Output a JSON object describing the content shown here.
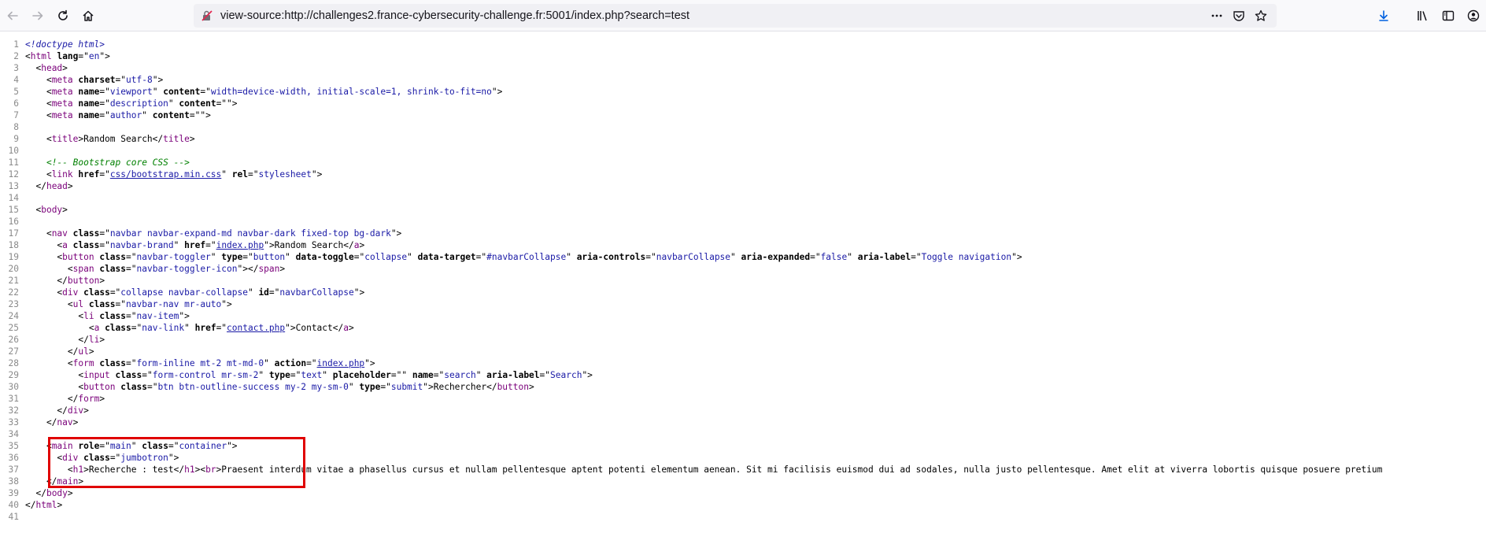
{
  "browser": {
    "url": "view-source:http://challenges2.france-cybersecurity-challenge.fr:5001/index.php?search=test",
    "icons": {
      "back": "back-arrow-icon",
      "forward": "forward-arrow-icon",
      "reload": "reload-icon",
      "home": "home-icon",
      "site_info": "site-info-icon",
      "page_actions": "more-icon",
      "pocket": "pocket-icon",
      "bookmark": "star-icon",
      "downloads": "download-icon",
      "library": "library-icon",
      "sidebar": "sidebar-icon",
      "account": "account-icon"
    }
  },
  "source": {
    "lines": [
      {
        "n": "1",
        "html": "<span class=\"dt\">&lt;!doctype html&gt;</span>"
      },
      {
        "n": "2",
        "html": "&lt;<span class=\"t\">html</span> <span class=\"an\">lang</span>=\"<span class=\"av\">en</span>\"&gt;"
      },
      {
        "n": "3",
        "html": "  &lt;<span class=\"t\">head</span>&gt;"
      },
      {
        "n": "4",
        "html": "    &lt;<span class=\"t\">meta</span> <span class=\"an\">charset</span>=\"<span class=\"av\">utf-8</span>\"&gt;"
      },
      {
        "n": "5",
        "html": "    &lt;<span class=\"t\">meta</span> <span class=\"an\">name</span>=\"<span class=\"av\">viewport</span>\" <span class=\"an\">content</span>=\"<span class=\"av\">width=device-width, initial-scale=1, shrink-to-fit=no</span>\"&gt;"
      },
      {
        "n": "6",
        "html": "    &lt;<span class=\"t\">meta</span> <span class=\"an\">name</span>=\"<span class=\"av\">description</span>\" <span class=\"an\">content</span>=\"\"&gt;"
      },
      {
        "n": "7",
        "html": "    &lt;<span class=\"t\">meta</span> <span class=\"an\">name</span>=\"<span class=\"av\">author</span>\" <span class=\"an\">content</span>=\"\"&gt;"
      },
      {
        "n": "8",
        "html": ""
      },
      {
        "n": "9",
        "html": "    &lt;<span class=\"t\">title</span>&gt;Random Search&lt;/<span class=\"t\">title</span>&gt;"
      },
      {
        "n": "10",
        "html": ""
      },
      {
        "n": "11",
        "html": "    <span class=\"cm\">&lt;!-- Bootstrap core CSS --&gt;</span>"
      },
      {
        "n": "12",
        "html": "    &lt;<span class=\"t\">link</span> <span class=\"an\">href</span>=\"<span class=\"lk\">css/bootstrap.min.css</span>\" <span class=\"an\">rel</span>=\"<span class=\"av\">stylesheet</span>\"&gt;"
      },
      {
        "n": "13",
        "html": "  &lt;/<span class=\"t\">head</span>&gt;"
      },
      {
        "n": "14",
        "html": ""
      },
      {
        "n": "15",
        "html": "  &lt;<span class=\"t\">body</span>&gt;"
      },
      {
        "n": "16",
        "html": ""
      },
      {
        "n": "17",
        "html": "    &lt;<span class=\"t\">nav</span> <span class=\"an\">class</span>=\"<span class=\"av\">navbar navbar-expand-md navbar-dark fixed-top bg-dark</span>\"&gt;"
      },
      {
        "n": "18",
        "html": "      &lt;<span class=\"t\">a</span> <span class=\"an\">class</span>=\"<span class=\"av\">navbar-brand</span>\" <span class=\"an\">href</span>=\"<span class=\"lk\">index.php</span>\"&gt;Random Search&lt;/<span class=\"t\">a</span>&gt;"
      },
      {
        "n": "19",
        "html": "      &lt;<span class=\"t\">button</span> <span class=\"an\">class</span>=\"<span class=\"av\">navbar-toggler</span>\" <span class=\"an\">type</span>=\"<span class=\"av\">button</span>\" <span class=\"an\">data-toggle</span>=\"<span class=\"av\">collapse</span>\" <span class=\"an\">data-target</span>=\"<span class=\"av\">#navbarCollapse</span>\" <span class=\"an\">aria-controls</span>=\"<span class=\"av\">navbarCollapse</span>\" <span class=\"an\">aria-expanded</span>=\"<span class=\"av\">false</span>\" <span class=\"an\">aria-label</span>=\"<span class=\"av\">Toggle navigation</span>\"&gt;"
      },
      {
        "n": "20",
        "html": "        &lt;<span class=\"t\">span</span> <span class=\"an\">class</span>=\"<span class=\"av\">navbar-toggler-icon</span>\"&gt;&lt;/<span class=\"t\">span</span>&gt;"
      },
      {
        "n": "21",
        "html": "      &lt;/<span class=\"t\">button</span>&gt;"
      },
      {
        "n": "22",
        "html": "      &lt;<span class=\"t\">div</span> <span class=\"an\">class</span>=\"<span class=\"av\">collapse navbar-collapse</span>\" <span class=\"an\">id</span>=\"<span class=\"av\">navbarCollapse</span>\"&gt;"
      },
      {
        "n": "23",
        "html": "        &lt;<span class=\"t\">ul</span> <span class=\"an\">class</span>=\"<span class=\"av\">navbar-nav mr-auto</span>\"&gt;"
      },
      {
        "n": "24",
        "html": "          &lt;<span class=\"t\">li</span> <span class=\"an\">class</span>=\"<span class=\"av\">nav-item</span>\"&gt;"
      },
      {
        "n": "25",
        "html": "            &lt;<span class=\"t\">a</span> <span class=\"an\">class</span>=\"<span class=\"av\">nav-link</span>\" <span class=\"an\">href</span>=\"<span class=\"lk\">contact.php</span>\"&gt;Contact&lt;/<span class=\"t\">a</span>&gt;"
      },
      {
        "n": "26",
        "html": "          &lt;/<span class=\"t\">li</span>&gt;"
      },
      {
        "n": "27",
        "html": "        &lt;/<span class=\"t\">ul</span>&gt;"
      },
      {
        "n": "28",
        "html": "        &lt;<span class=\"t\">form</span> <span class=\"an\">class</span>=\"<span class=\"av\">form-inline mt-2 mt-md-0</span>\" <span class=\"an\">action</span>=\"<span class=\"lk\">index.php</span>\"&gt;"
      },
      {
        "n": "29",
        "html": "          &lt;<span class=\"t\">input</span> <span class=\"an\">class</span>=\"<span class=\"av\">form-control mr-sm-2</span>\" <span class=\"an\">type</span>=\"<span class=\"av\">text</span>\" <span class=\"an\">placeholder</span>=\"\" <span class=\"an\">name</span>=\"<span class=\"av\">search</span>\" <span class=\"an\">aria-label</span>=\"<span class=\"av\">Search</span>\"&gt;"
      },
      {
        "n": "30",
        "html": "          &lt;<span class=\"t\">button</span> <span class=\"an\">class</span>=\"<span class=\"av\">btn btn-outline-success my-2 my-sm-0</span>\" <span class=\"an\">type</span>=\"<span class=\"av\">submit</span>\"&gt;Rechercher&lt;/<span class=\"t\">button</span>&gt;"
      },
      {
        "n": "31",
        "html": "        &lt;/<span class=\"t\">form</span>&gt;"
      },
      {
        "n": "32",
        "html": "      &lt;/<span class=\"t\">div</span>&gt;"
      },
      {
        "n": "33",
        "html": "    &lt;/<span class=\"t\">nav</span>&gt;"
      },
      {
        "n": "34",
        "html": ""
      },
      {
        "n": "35",
        "html": "    &lt;<span class=\"t\">main</span> <span class=\"an\">role</span>=\"<span class=\"av\">main</span>\" <span class=\"an\">class</span>=\"<span class=\"av\">container</span>\"&gt;"
      },
      {
        "n": "36",
        "html": "      &lt;<span class=\"t\">div</span> <span class=\"an\">class</span>=\"<span class=\"av\">jumbotron</span>\"&gt;"
      },
      {
        "n": "37",
        "html": "        &lt;<span class=\"t\">h1</span>&gt;Recherche : test&lt;/<span class=\"t\">h1</span>&gt;&lt;<span class=\"t\">br</span>&gt;Praesent interdum vitae a phasellus cursus et nullam pellentesque aptent potenti elementum aenean. Sit mi facilisis euismod dui ad sodales, nulla justo pellentesque. Amet elit at viverra lobortis quisque posuere pretium"
      },
      {
        "n": "38",
        "html": "    &lt;/<span class=\"t\">main</span>&gt;"
      },
      {
        "n": "39",
        "html": "  &lt;/<span class=\"t\">body</span>&gt;"
      },
      {
        "n": "40",
        "html": "&lt;/<span class=\"t\">html</span>&gt;"
      },
      {
        "n": "41",
        "html": ""
      }
    ]
  }
}
